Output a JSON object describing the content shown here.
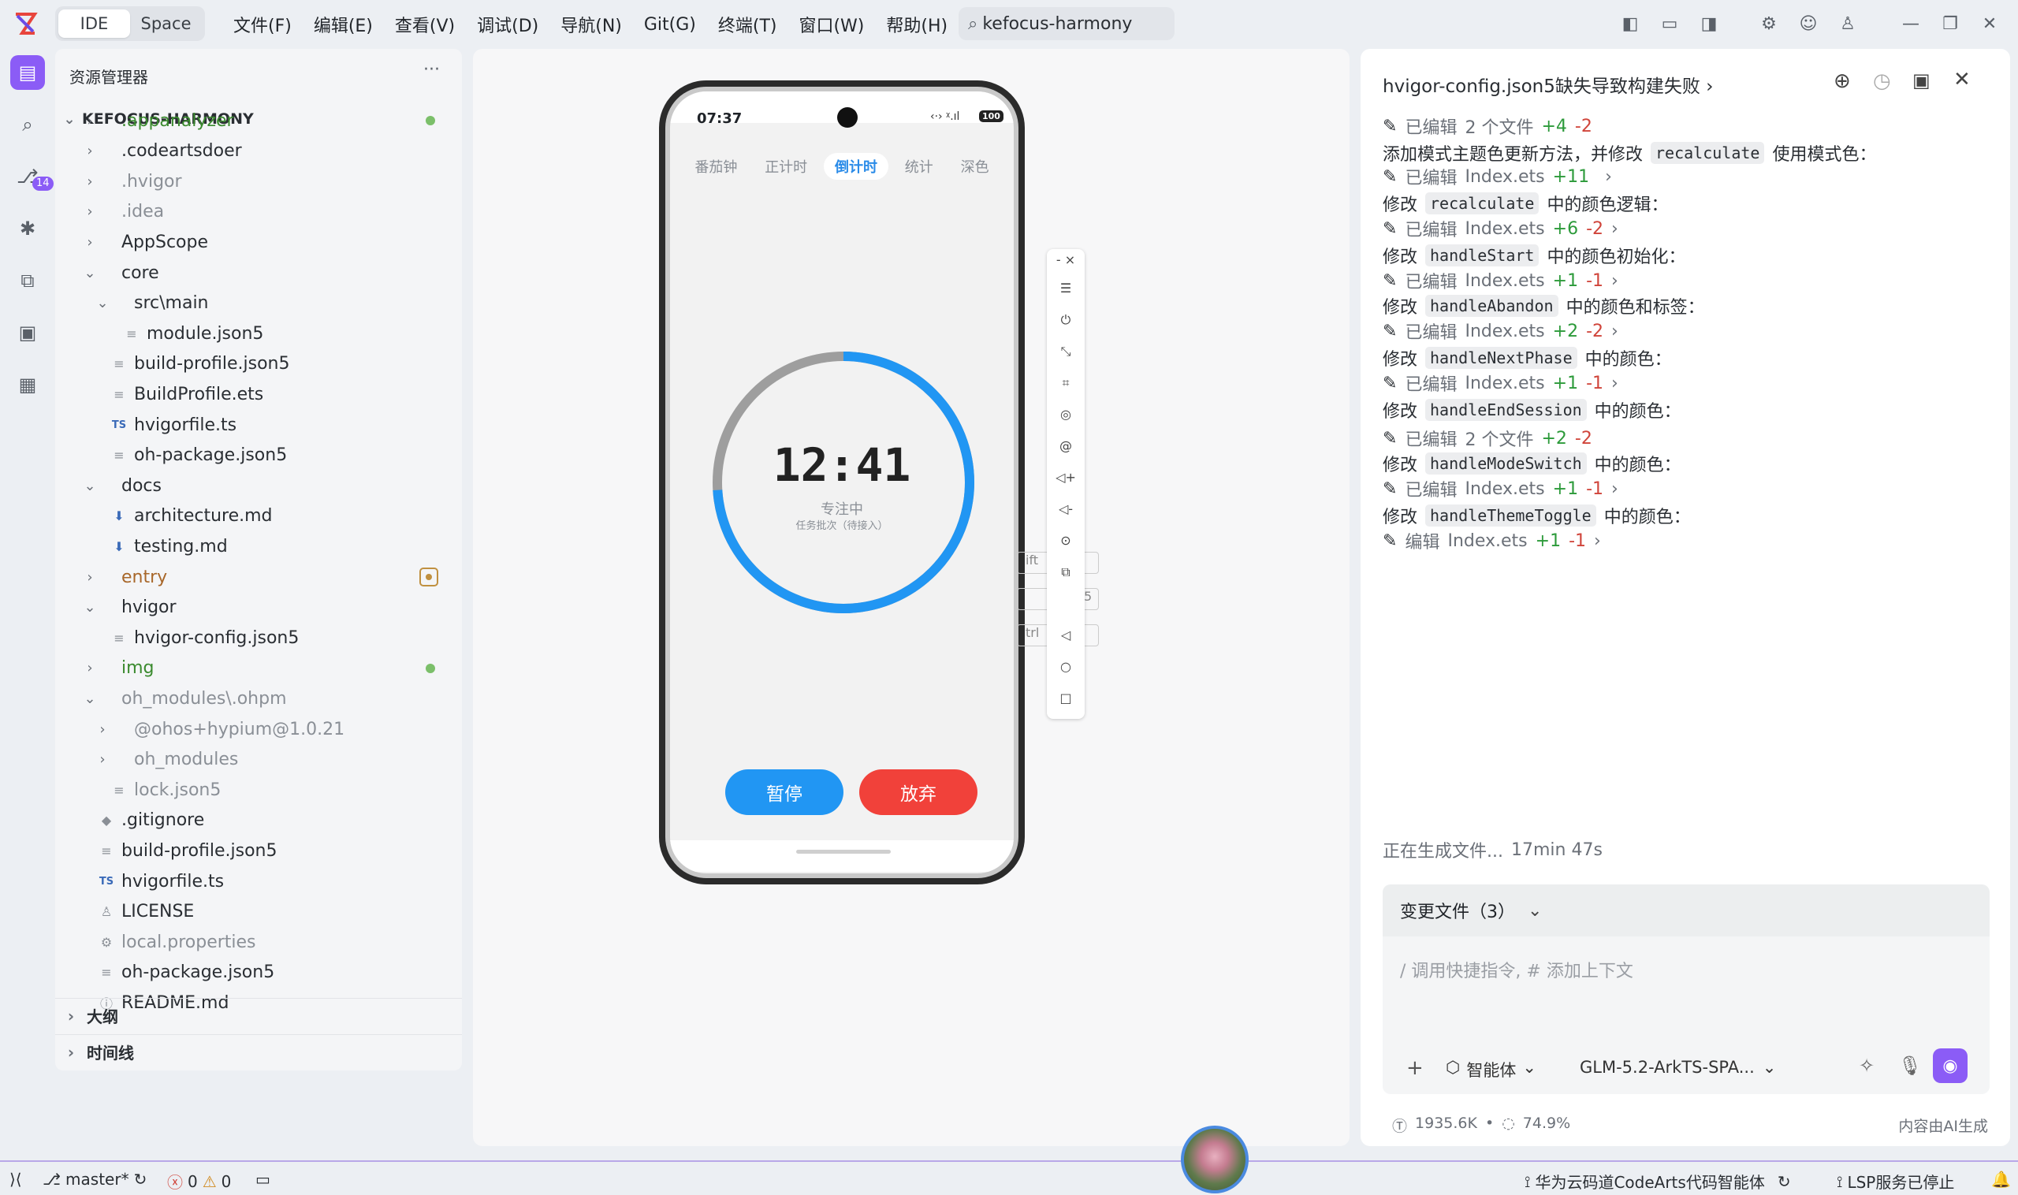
{
  "topbar": {
    "seg_ide": "IDE",
    "seg_space": "Space",
    "menus": [
      "文件(F)",
      "编辑(E)",
      "查看(V)",
      "调试(D)",
      "导航(N)",
      "Git(G)",
      "终端(T)",
      "窗口(W)",
      "帮助(H)"
    ],
    "search": "kefocus-harmony"
  },
  "leftbar": {
    "badge": "14"
  },
  "explorer": {
    "title": "资源管理器",
    "more": "···",
    "root": "KEFOCUS-HARMONY",
    "items": [
      {
        "label": ".appanalyzer",
        "chev": "›",
        "icon": "",
        "cls": "green",
        "indent": 0,
        "dot": "green"
      },
      {
        "label": ".codeartsdoer",
        "chev": "›",
        "icon": "",
        "cls": "",
        "indent": 0
      },
      {
        "label": ".hvigor",
        "chev": "›",
        "icon": "",
        "cls": "gray",
        "indent": 0
      },
      {
        "label": ".idea",
        "chev": "›",
        "icon": "",
        "cls": "gray",
        "indent": 0
      },
      {
        "label": "AppScope",
        "chev": "›",
        "icon": "",
        "cls": "",
        "indent": 0
      },
      {
        "label": "core",
        "chev": "⌄",
        "icon": "",
        "cls": "",
        "indent": 0
      },
      {
        "label": "src\\main",
        "chev": "⌄",
        "icon": "",
        "cls": "",
        "indent": 1
      },
      {
        "label": "module.json5",
        "chev": "",
        "icon": "≡",
        "cls": "",
        "indent": 2
      },
      {
        "label": "build-profile.json5",
        "chev": "",
        "icon": "≡",
        "cls": "",
        "indent": 1
      },
      {
        "label": "BuildProfile.ets",
        "chev": "",
        "icon": "≡",
        "cls": "",
        "indent": 1
      },
      {
        "label": "hvigorfile.ts",
        "chev": "",
        "icon": "TS",
        "cls": "",
        "indent": 1
      },
      {
        "label": "oh-package.json5",
        "chev": "",
        "icon": "≡",
        "cls": "",
        "indent": 1
      },
      {
        "label": "docs",
        "chev": "⌄",
        "icon": "",
        "cls": "",
        "indent": 0
      },
      {
        "label": "architecture.md",
        "chev": "",
        "icon": "⬇",
        "cls": "",
        "indent": 1
      },
      {
        "label": "testing.md",
        "chev": "",
        "icon": "⬇",
        "cls": "",
        "indent": 1
      },
      {
        "label": "entry",
        "chev": "›",
        "icon": "",
        "cls": "brown",
        "indent": 0,
        "dot": "square"
      },
      {
        "label": "hvigor",
        "chev": "⌄",
        "icon": "",
        "cls": "",
        "indent": 0
      },
      {
        "label": "hvigor-config.json5",
        "chev": "",
        "icon": "≡",
        "cls": "",
        "indent": 1
      },
      {
        "label": "img",
        "chev": "›",
        "icon": "",
        "cls": "green",
        "indent": 0,
        "dot": "green"
      },
      {
        "label": "oh_modules\\.ohpm",
        "chev": "⌄",
        "icon": "",
        "cls": "gray",
        "indent": 0
      },
      {
        "label": "@ohos+hypium@1.0.21",
        "chev": "›",
        "icon": "",
        "cls": "gray",
        "indent": 1
      },
      {
        "label": "oh_modules",
        "chev": "›",
        "icon": "",
        "cls": "gray",
        "indent": 1
      },
      {
        "label": "lock.json5",
        "chev": "",
        "icon": "≡",
        "cls": "gray",
        "indent": 1
      },
      {
        "label": ".gitignore",
        "chev": "",
        "icon": "◆",
        "cls": "",
        "indent": 0
      },
      {
        "label": "build-profile.json5",
        "chev": "",
        "icon": "≡",
        "cls": "",
        "indent": 0
      },
      {
        "label": "hvigorfile.ts",
        "chev": "",
        "icon": "TS",
        "cls": "",
        "indent": 0
      },
      {
        "label": "LICENSE",
        "chev": "",
        "icon": "♙",
        "cls": "",
        "indent": 0
      },
      {
        "label": "local.properties",
        "chev": "",
        "icon": "⚙",
        "cls": "gray",
        "indent": 0
      },
      {
        "label": "oh-package.json5",
        "chev": "",
        "icon": "≡",
        "cls": "",
        "indent": 0
      },
      {
        "label": "README.md",
        "chev": "",
        "icon": "ⓘ",
        "cls": "",
        "indent": 0
      }
    ],
    "outline": "大纲",
    "timeline": "时间线"
  },
  "phone": {
    "time": "07:37",
    "battery": "100",
    "tabs": [
      "番茄钟",
      "正计时",
      "倒计时",
      "统计",
      "深色"
    ],
    "active_tab": 2,
    "timer": "12:41",
    "status": "专注中",
    "subtitle": "任务批次（待接入）",
    "progress": 0.74,
    "pause": "暂停",
    "abandon": "放弃"
  },
  "overlay_keys": [
    "ift",
    "5",
    "trl"
  ],
  "chat": {
    "title": "hvigor-config.json5缺失导致构建失败",
    "lines": [
      {
        "type": "edit",
        "verb": "已编辑",
        "file": "2 个文件",
        "add": "+4",
        "del": "-2",
        "arrow": ""
      },
      {
        "type": "text",
        "pre": "添加模式主题色更新方法，并修改",
        "code": "recalculate",
        "post": "使用模式色："
      },
      {
        "type": "edit",
        "verb": "已编辑",
        "file": "Index.ets",
        "add": "+11",
        "del": "",
        "arrow": "›"
      },
      {
        "type": "text",
        "pre": "修改",
        "code": "recalculate",
        "post": "中的颜色逻辑："
      },
      {
        "type": "edit",
        "verb": "已编辑",
        "file": "Index.ets",
        "add": "+6",
        "del": "-2",
        "arrow": "›"
      },
      {
        "type": "text",
        "pre": "修改",
        "code": "handleStart",
        "post": "中的颜色初始化："
      },
      {
        "type": "edit",
        "verb": "已编辑",
        "file": "Index.ets",
        "add": "+1",
        "del": "-1",
        "arrow": "›"
      },
      {
        "type": "text",
        "pre": "修改",
        "code": "handleAbandon",
        "post": "中的颜色和标签："
      },
      {
        "type": "edit",
        "verb": "已编辑",
        "file": "Index.ets",
        "add": "+2",
        "del": "-2",
        "arrow": "›"
      },
      {
        "type": "text",
        "pre": "修改",
        "code": "handleNextPhase",
        "post": "中的颜色："
      },
      {
        "type": "edit",
        "verb": "已编辑",
        "file": "Index.ets",
        "add": "+1",
        "del": "-1",
        "arrow": "›"
      },
      {
        "type": "text",
        "pre": "修改",
        "code": "handleEndSession",
        "post": "中的颜色："
      },
      {
        "type": "edit",
        "verb": "已编辑",
        "file": "2 个文件",
        "add": "+2",
        "del": "-2",
        "arrow": ""
      },
      {
        "type": "text",
        "pre": "修改",
        "code": "handleModeSwitch",
        "post": "中的颜色："
      },
      {
        "type": "edit",
        "verb": "已编辑",
        "file": "Index.ets",
        "add": "+1",
        "del": "-1",
        "arrow": "›"
      },
      {
        "type": "text",
        "pre": "修改",
        "code": "handleThemeToggle",
        "post": "中的颜色："
      },
      {
        "type": "edit",
        "verb": "编辑",
        "file": "Index.ets",
        "add": "+1",
        "del": "-1",
        "arrow": "›"
      }
    ],
    "generating": "正在生成文件...",
    "elapsed": "17min 47s",
    "changes": "变更文件（3）",
    "placeholder": "/ 调用快捷指令, # 添加上下文",
    "agent": "智能体",
    "model": "GLM-5.2-ArkTS-SPA...",
    "tokens": "1935.6K",
    "usage": "74.9%",
    "ai_note": "内容由AI生成"
  },
  "status": {
    "branch": "master*",
    "errors": "0",
    "warnings": "0",
    "service": "华为云码道CodeArts代码智能体",
    "lsp": "LSP服务已停止"
  }
}
